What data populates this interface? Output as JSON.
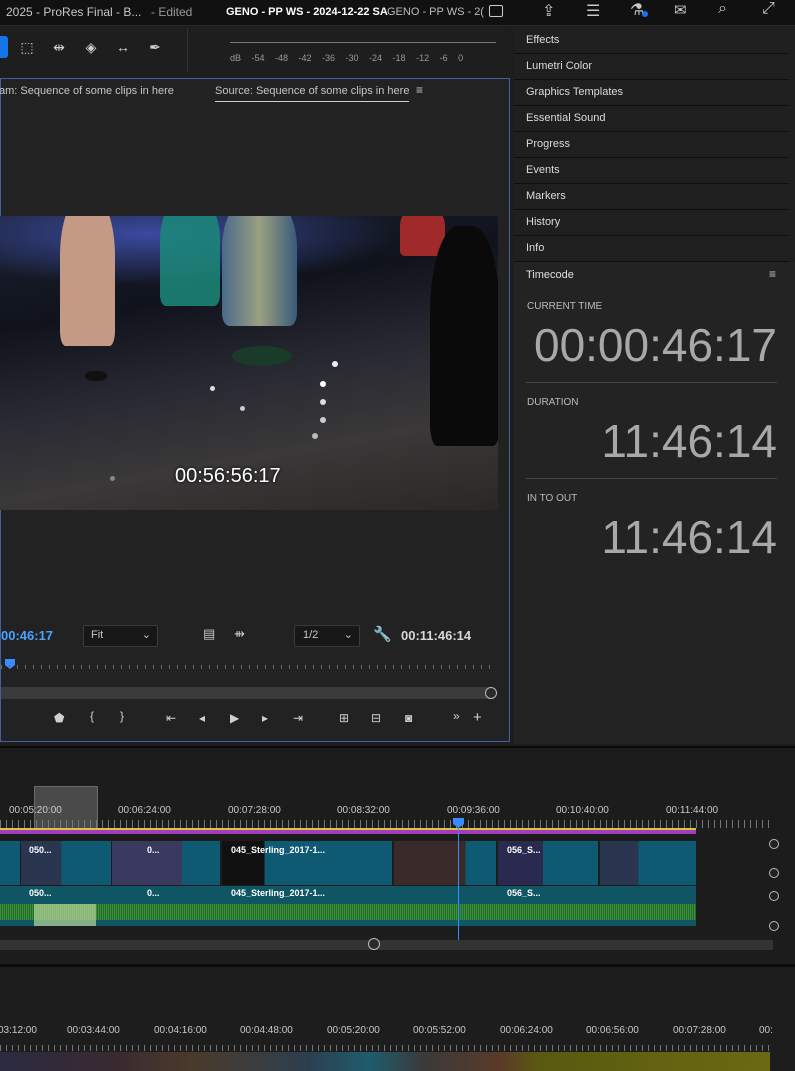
{
  "topbar": {
    "title_left": "2025 - ProRes Final - B...",
    "edited": "- Edited",
    "project_active": "GENO - PP WS - 2024-12-22 SA",
    "project_tab2": "GENO - PP WS - 2("
  },
  "meter": {
    "labels": "dB -54 -48 -42 -36 -30 -24 -18 -12 -6 0"
  },
  "monitor": {
    "tab_program": "am: Sequence of some clips in here",
    "tab_source": "Source: Sequence of some clips in here",
    "timecode_overlay": "00:56:56:17",
    "current_time": "00:46:17",
    "fit": "Fit",
    "resolution": "1/2",
    "duration": "00:11:46:14"
  },
  "panels": {
    "items": [
      "Effects",
      "Lumetri Color",
      "Graphics Templates",
      "Essential Sound",
      "Progress",
      "Events",
      "Markers",
      "History",
      "Info",
      "Timecode"
    ]
  },
  "timecode_panel": {
    "current_label": "CURRENT TIME",
    "current_value": "00:00:46:17",
    "duration_label": "DURATION",
    "duration_value": "11:46:14",
    "in_out_label": "IN TO OUT",
    "in_out_value": "11:46:14"
  },
  "timeline1": {
    "ruler": [
      "00:05:20:00",
      "00:06:24:00",
      "00:07:28:00",
      "00:08:32:00",
      "00:09:36:00",
      "00:10:40:00",
      "00:11:44:00"
    ],
    "clips_video": [
      "050...",
      "0...",
      "045_Sterling_2017-1...",
      "056_S..."
    ],
    "clips_audio": [
      "050...",
      "0...",
      "045_Sterling_2017-1...",
      "056_S..."
    ]
  },
  "timeline2": {
    "ruler": [
      "03:12:00",
      "00:03:44:00",
      "00:04:16:00",
      "00:04:48:00",
      "00:05:20:00",
      "00:05:52:00",
      "00:06:24:00",
      "00:06:56:00",
      "00:07:28:00",
      "00:"
    ]
  }
}
